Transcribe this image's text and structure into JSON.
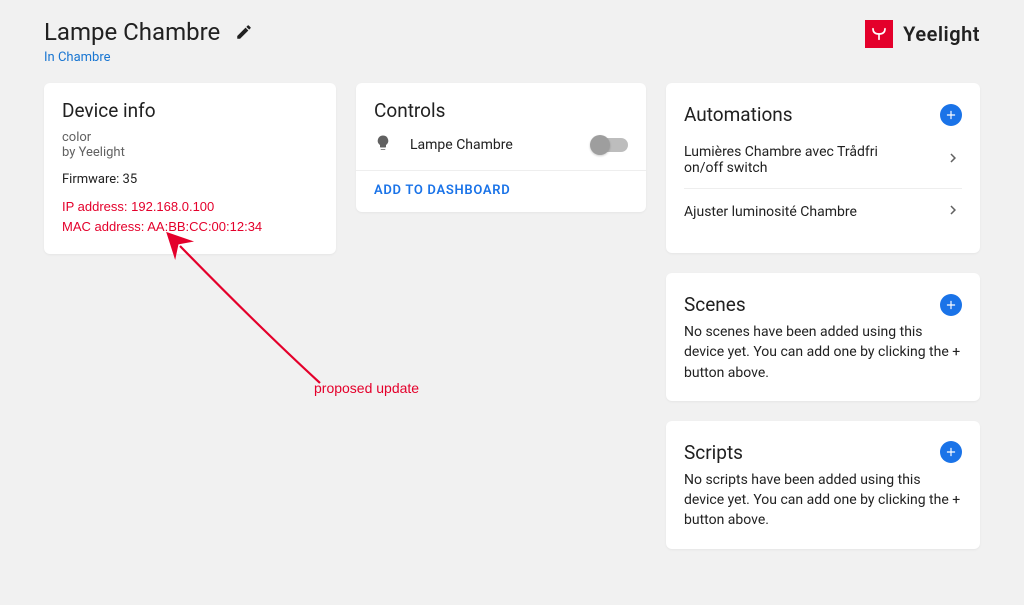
{
  "header": {
    "device_name": "Lampe Chambre",
    "location_prefix": "In ",
    "location_room": "Chambre"
  },
  "brand": {
    "name": "Yeelight"
  },
  "device_info": {
    "title": "Device info",
    "model": "color",
    "by": "by Yeelight",
    "firmware_label": "Firmware: 35",
    "ip_line": "IP address: 192.168.0.100",
    "mac_line": "MAC address: AA:BB:CC:00:12:34"
  },
  "controls": {
    "title": "Controls",
    "entity_name": "Lampe Chambre",
    "switch_on": false,
    "add_to_dashboard": "ADD TO DASHBOARD"
  },
  "automations": {
    "title": "Automations",
    "items": [
      {
        "label": "Lumières Chambre avec Trådfri on/off switch"
      },
      {
        "label": "Ajuster luminosité Chambre"
      }
    ]
  },
  "scenes": {
    "title": "Scenes",
    "empty": "No scenes have been added using this device yet. You can add one by clicking the + button above."
  },
  "scripts": {
    "title": "Scripts",
    "empty": "No scripts have been added using this device yet. You can add one by clicking the + button above."
  },
  "annotation": {
    "label": "proposed update"
  }
}
